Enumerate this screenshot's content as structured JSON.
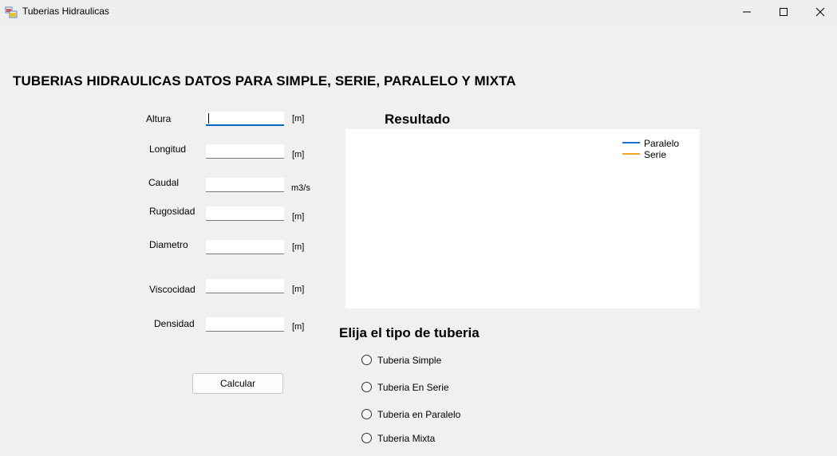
{
  "window": {
    "title": "Tuberias Hidraulicas",
    "controls": [
      "minimize-icon",
      "maximize-icon",
      "close-icon"
    ]
  },
  "main_title": "TUBERIAS HIDRAULICAS DATOS PARA SIMPLE, SERIE, PARALELO Y MIXTA",
  "fields": [
    {
      "label": "Altura",
      "unit": "[m]",
      "value": "",
      "focused": true
    },
    {
      "label": "Longitud",
      "unit": "[m]",
      "value": ""
    },
    {
      "label": "Caudal",
      "unit": "m3/s",
      "value": ""
    },
    {
      "label": "Rugosidad",
      "unit": "[m]",
      "value": ""
    },
    {
      "label": "Diametro",
      "unit": "[m]",
      "value": ""
    },
    {
      "label": "Viscocidad",
      "unit": "[m]",
      "value": ""
    },
    {
      "label": "Densidad",
      "unit": "[m]",
      "value": ""
    }
  ],
  "calc_button": "Calcular",
  "result": {
    "title": "Resultado",
    "legend": [
      {
        "name": "Paralelo",
        "color": "#1e73d2"
      },
      {
        "name": "Serie",
        "color": "#f5a623"
      }
    ]
  },
  "pipe_type": {
    "title": "Elija el tipo de tuberia",
    "options": [
      "Tuberia Simple",
      "Tuberia En Serie",
      "Tuberia en Paralelo",
      "Tuberia Mixta"
    ]
  }
}
